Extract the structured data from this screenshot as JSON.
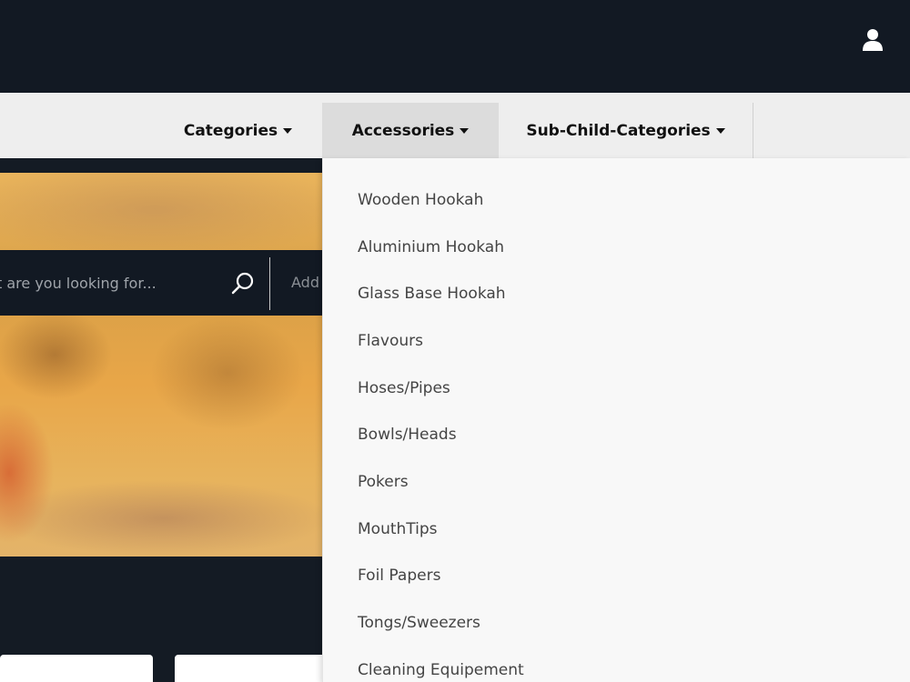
{
  "header": {
    "user_icon": "user-icon"
  },
  "nav": {
    "items": [
      {
        "label": "Categories"
      },
      {
        "label": "Accessories"
      },
      {
        "label": "Sub-Child-Categories"
      }
    ],
    "active_index": 1
  },
  "search": {
    "placeholder": "t are you looking for...",
    "address_placeholder": "Add",
    "icon": "search-icon"
  },
  "dropdown": {
    "items": [
      "Wooden Hookah",
      "Aluminium Hookah",
      "Glass Base Hookah",
      "Flavours",
      "Hoses/Pipes",
      "Bowls/Heads",
      "Pokers",
      "MouthTips",
      "Foil Papers",
      "Tongs/Sweezers",
      "Cleaning Equipement"
    ]
  },
  "colors": {
    "header_bg": "#121923",
    "nav_bg": "#eeeeee",
    "nav_active_bg": "#dcdcdc",
    "dropdown_bg": "#f8f8f8"
  }
}
